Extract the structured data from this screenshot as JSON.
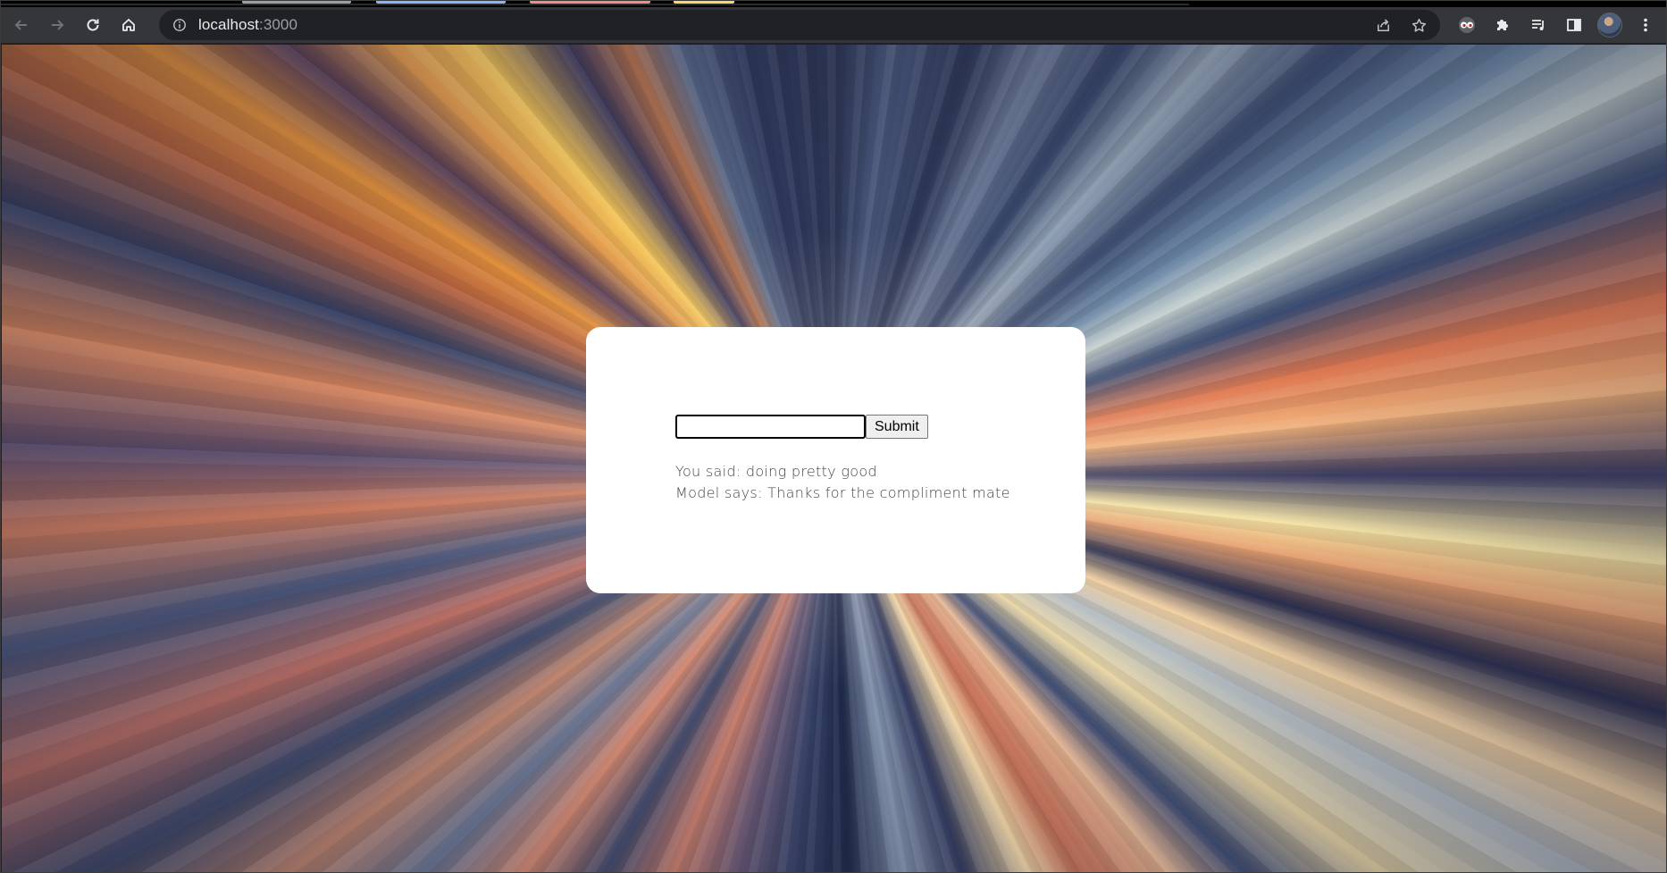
{
  "browser": {
    "url_host": "localhost",
    "url_port": ":3000",
    "tab_colors": [
      "#9aa0a6",
      "#8ab4f8",
      "#f28b82",
      "#fdd663"
    ]
  },
  "icons": {
    "back": "arrow-left-icon",
    "forward": "arrow-right-icon",
    "reload": "reload-icon",
    "home": "home-icon",
    "site_info": "info-icon",
    "share": "share-icon",
    "bookmark": "star-icon",
    "extension_eyes": "eyes-extension-icon",
    "extensions": "puzzle-icon",
    "media": "media-queue-icon",
    "side_panel": "side-panel-icon",
    "profile": "avatar",
    "menu": "kebab-menu-icon"
  },
  "form": {
    "input_value": "",
    "input_placeholder": "",
    "submit_label": "Submit"
  },
  "messages": {
    "user_line": "You said: doing pretty good",
    "model_line": "Model says: Thanks for the compliment mate"
  }
}
